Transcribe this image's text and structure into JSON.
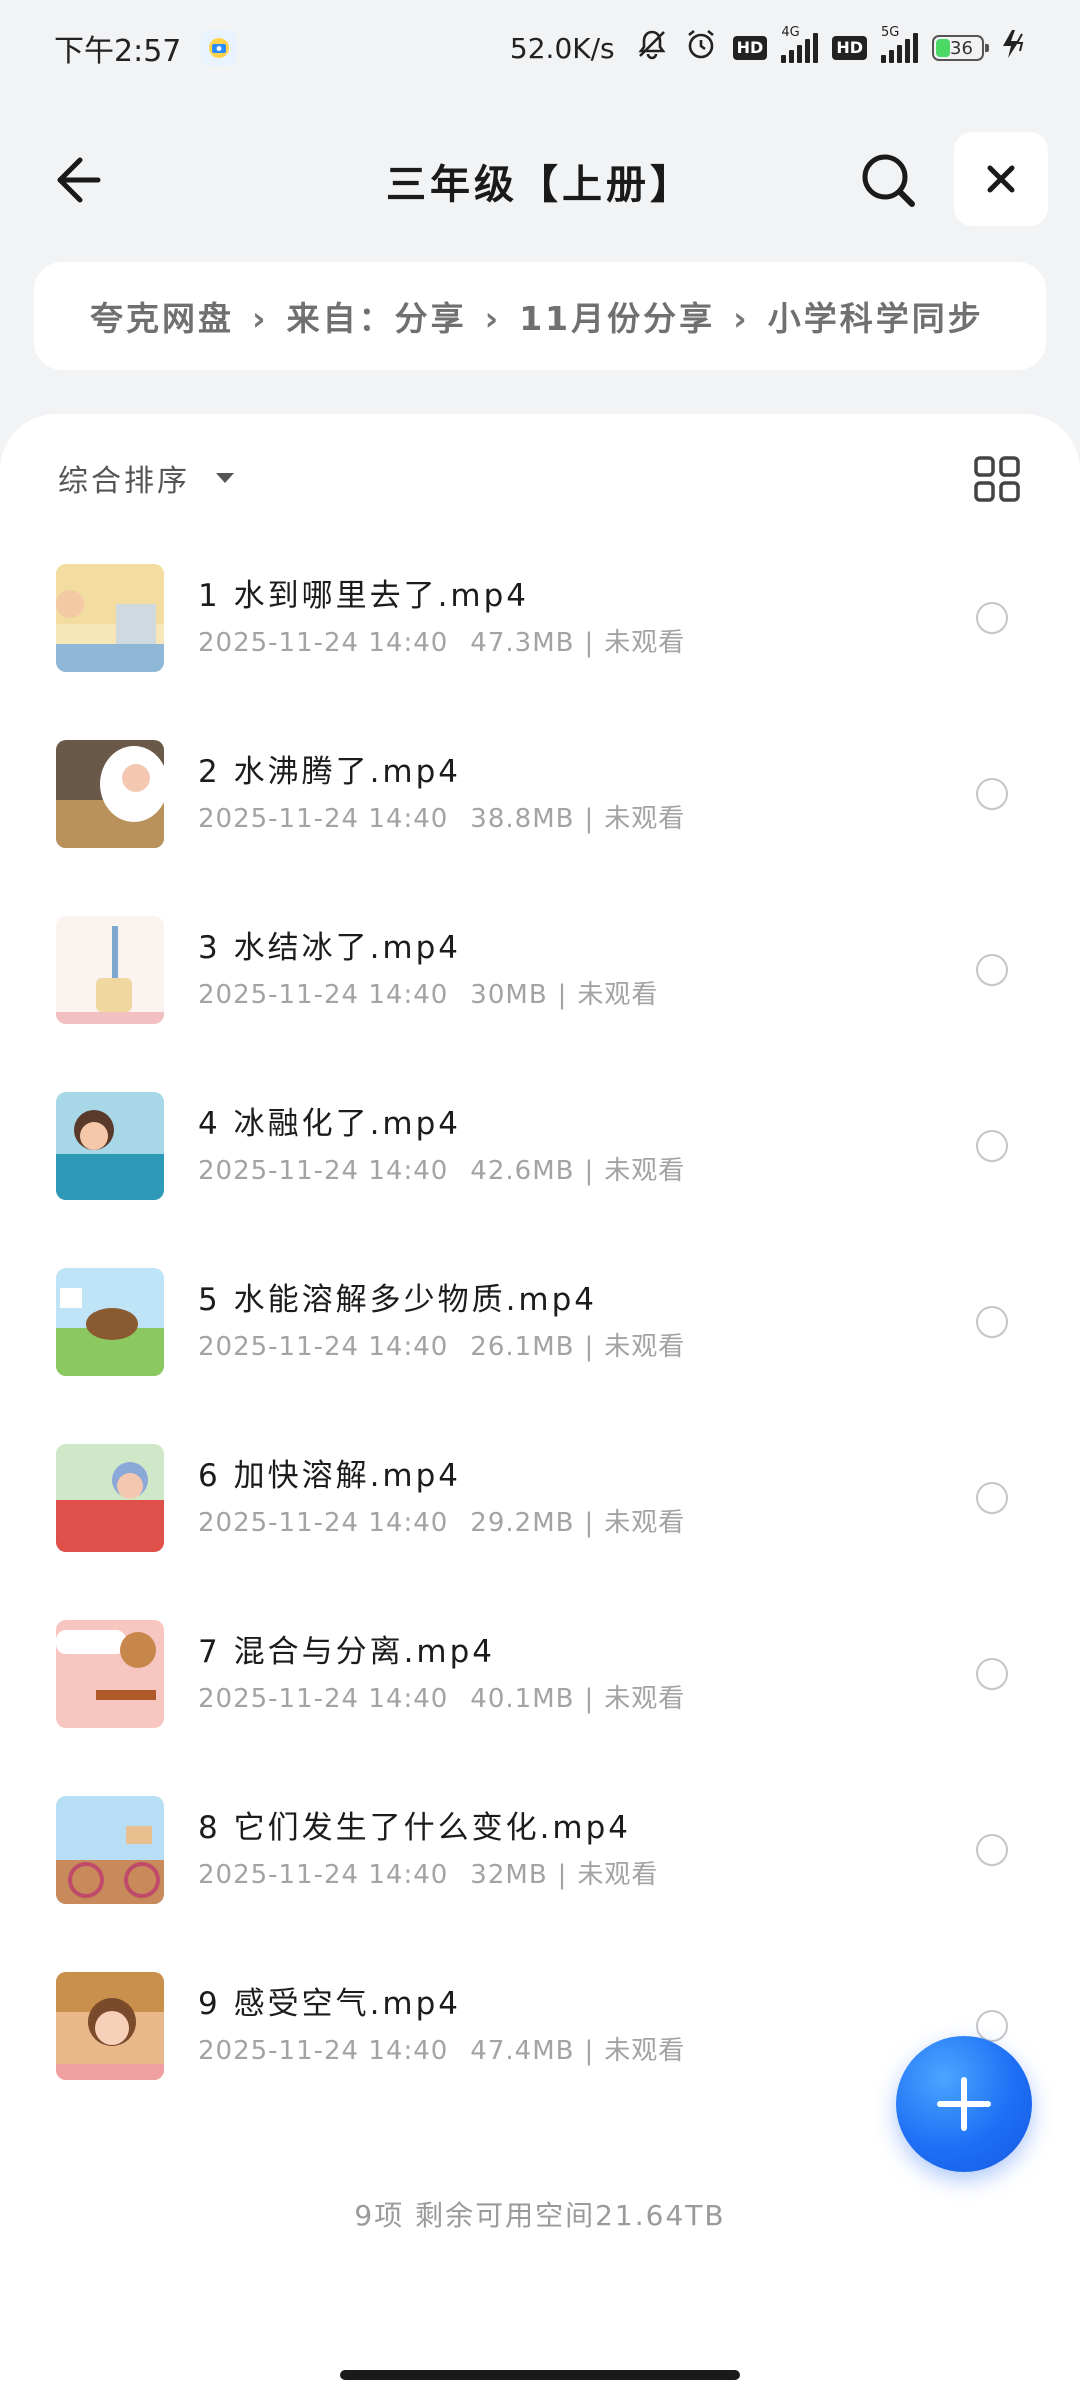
{
  "status_bar": {
    "time": "下午2:57",
    "net_speed": "52.0K/s",
    "hd1": "HD",
    "net1": "4G",
    "hd2": "HD",
    "net2": "5G",
    "battery": "36"
  },
  "header": {
    "title": "三年级【上册】"
  },
  "breadcrumb": {
    "items": [
      "夸克网盘",
      "来自：分享",
      "11月份分享",
      "小学科学同步"
    ]
  },
  "toolbar": {
    "sort_label": "综合排序"
  },
  "files": [
    {
      "name": "1 水到哪里去了.mp4",
      "date": "2025-11-24 14:40",
      "size": "47.3MB",
      "status": "未观看"
    },
    {
      "name": "2 水沸腾了.mp4",
      "date": "2025-11-24 14:40",
      "size": "38.8MB",
      "status": "未观看"
    },
    {
      "name": "3 水结冰了.mp4",
      "date": "2025-11-24 14:40",
      "size": "30MB",
      "status": "未观看"
    },
    {
      "name": "4 冰融化了.mp4",
      "date": "2025-11-24 14:40",
      "size": "42.6MB",
      "status": "未观看"
    },
    {
      "name": "5 水能溶解多少物质.mp4",
      "date": "2025-11-24 14:40",
      "size": "26.1MB",
      "status": "未观看"
    },
    {
      "name": "6 加快溶解.mp4",
      "date": "2025-11-24 14:40",
      "size": "29.2MB",
      "status": "未观看"
    },
    {
      "name": "7 混合与分离.mp4",
      "date": "2025-11-24 14:40",
      "size": "40.1MB",
      "status": "未观看"
    },
    {
      "name": "8 它们发生了什么变化.mp4",
      "date": "2025-11-24 14:40",
      "size": "32MB",
      "status": "未观看"
    },
    {
      "name": "9 感受空气.mp4",
      "date": "2025-11-24 14:40",
      "size": "47.4MB",
      "status": "未观看"
    }
  ],
  "footer": {
    "summary": "9项  剩余可用空间21.64TB"
  },
  "colors": {
    "accent": "#1e6ff5",
    "page_bg": "#f2f3f5"
  }
}
